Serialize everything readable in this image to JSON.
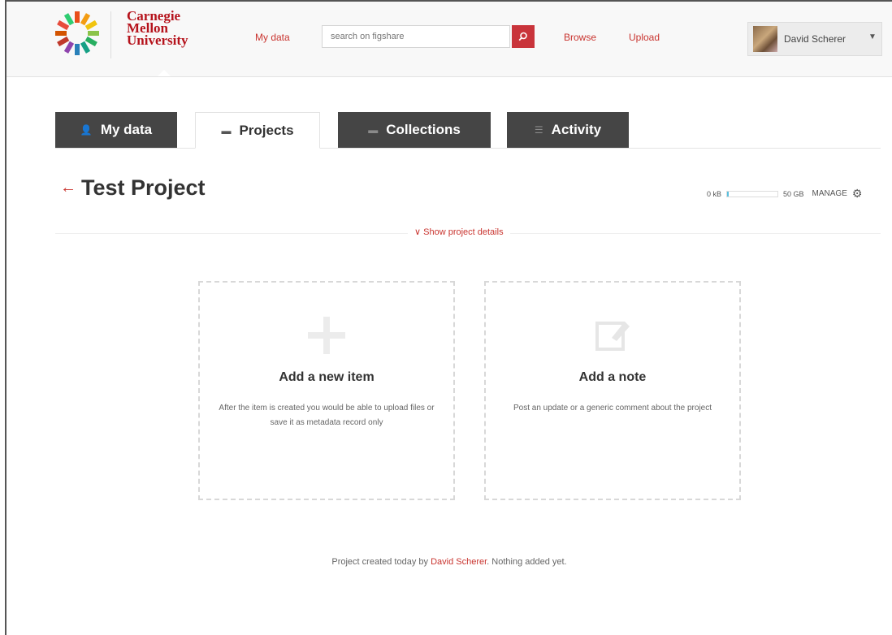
{
  "header": {
    "logo": {
      "line1": "Carnegie",
      "line2": "Mellon",
      "line3": "University",
      "brand_color": "#b5121b"
    },
    "nav": {
      "my_data": "My data",
      "browse": "Browse",
      "upload": "Upload"
    },
    "search": {
      "placeholder": "search on figshare",
      "icon": "search-icon"
    },
    "user": {
      "name": "David Scherer",
      "caret_icon": "caret-down-icon"
    }
  },
  "tabs": [
    {
      "label": "My data",
      "icon": "user-icon",
      "active": false
    },
    {
      "label": "Projects",
      "icon": "folder-icon",
      "active": true
    },
    {
      "label": "Collections",
      "icon": "comment-icon",
      "active": false
    },
    {
      "label": "Activity",
      "icon": "list-icon",
      "active": false
    }
  ],
  "project": {
    "back_icon": "arrow-left-icon",
    "title": "Test Project",
    "storage": {
      "used": "0 kB",
      "total": "50 GB",
      "fraction_used": 0.0,
      "bar_color": "#5bc0de"
    },
    "manage_label": "MANAGE",
    "details_toggle": "Show project details"
  },
  "cards": [
    {
      "title": "Add a new item",
      "text": "After the item is created you would be able to upload files or save it as metadata record only",
      "icon": "plus-icon"
    },
    {
      "title": "Add a note",
      "text": "Post an update or a generic comment about the project",
      "icon": "edit-note-icon"
    }
  ],
  "footer": {
    "prefix": "Project created today by",
    "author": "David Scherer",
    "suffix": ". Nothing added yet."
  },
  "colors": {
    "accent": "#c9342f",
    "tab_dark": "#454545"
  }
}
